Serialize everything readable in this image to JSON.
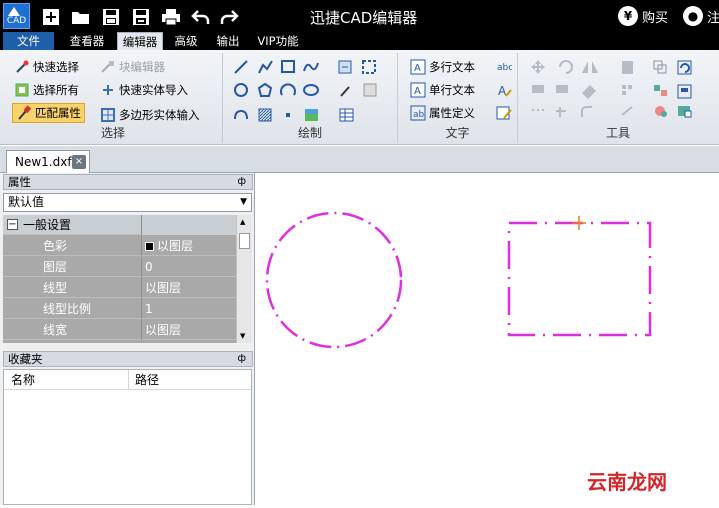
{
  "app": {
    "title": "迅捷CAD编辑器",
    "logo_text": "CAD"
  },
  "titlebar_right": {
    "buy_label": "购买",
    "register_label": "注"
  },
  "menu": {
    "items": [
      "文件",
      "查看器",
      "编辑器",
      "高级",
      "输出",
      "VIP功能"
    ],
    "active": "编辑器"
  },
  "ribbon": {
    "select_group": {
      "label": "选择",
      "quick_select": "快速选择",
      "block_editor": "块编辑器",
      "select_all": "选择所有",
      "quick_entity_import": "快速实体导入",
      "match_props": "匹配属性",
      "polygon_entity_input": "多边形实体输入"
    },
    "draw_group": {
      "label": "绘制"
    },
    "text_group": {
      "label": "文字",
      "mtext": "多行文本",
      "stext": "单行文本",
      "attdef": "属性定义"
    },
    "tools_group": {
      "label": "工具"
    }
  },
  "doc_tab": {
    "name": "New1.dxf",
    "close": "×"
  },
  "properties": {
    "title": "属性",
    "pin": "ф",
    "combo_value": "默认值",
    "section": "一般设置",
    "section_toggle": "−",
    "rows": [
      {
        "key": "色彩",
        "value": "以图层"
      },
      {
        "key": "图层",
        "value": "0"
      },
      {
        "key": "线型",
        "value": "以图层"
      },
      {
        "key": "线型比例",
        "value": "1"
      },
      {
        "key": "线宽",
        "value": "以图层"
      }
    ]
  },
  "favorites": {
    "title": "收藏夹",
    "pin": "ф",
    "col_name": "名称",
    "col_path": "路径"
  },
  "canvas": {
    "entity_color": "#e02de0",
    "cursor_color": "#f07820"
  },
  "watermark": "云南龙网"
}
